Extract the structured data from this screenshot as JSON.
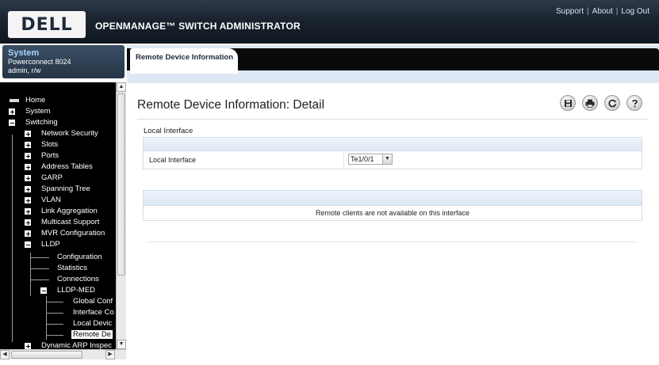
{
  "header": {
    "logo": "DELL",
    "product": "OPENMANAGE™ SWITCH ADMINISTRATOR",
    "links": [
      "Support",
      "About",
      "Log Out"
    ],
    "separator": "|"
  },
  "system_box": {
    "title": "System",
    "model": "Powerconnect 8024",
    "user": "admin, r/w"
  },
  "nav_tree": {
    "items": [
      {
        "label": "Home"
      },
      {
        "label": "System"
      },
      {
        "label": "Switching"
      },
      {
        "label": "Network Security"
      },
      {
        "label": "Slots"
      },
      {
        "label": "Ports"
      },
      {
        "label": "Address Tables"
      },
      {
        "label": "GARP"
      },
      {
        "label": "Spanning Tree"
      },
      {
        "label": "VLAN"
      },
      {
        "label": "Link Aggregation"
      },
      {
        "label": "Multicast Support"
      },
      {
        "label": "MVR Configuration"
      },
      {
        "label": "LLDP"
      },
      {
        "label": "Configuration"
      },
      {
        "label": "Statistics"
      },
      {
        "label": "Connections"
      },
      {
        "label": "LLDP-MED"
      },
      {
        "label": "Global Conf"
      },
      {
        "label": "Interface Co"
      },
      {
        "label": "Local Devic"
      },
      {
        "label": "Remote De"
      },
      {
        "label": "Dynamic ARP Inspec"
      }
    ],
    "selected": "Remote De"
  },
  "tab": {
    "label": "Remote Device Information"
  },
  "page": {
    "title": "Remote Device Information: Detail",
    "toolbar": [
      "save-icon",
      "print-icon",
      "refresh-icon",
      "help-icon"
    ],
    "local_section": {
      "title": "Local Interface",
      "field_label": "Local Interface",
      "selected_value": "Te1/0/1"
    },
    "remote_message": "Remote clients are not available on this interface"
  },
  "colors": {
    "header_bg": "#1a2430",
    "tree_bg": "#000000",
    "panel_header": "#dde8f4",
    "tab_strip": "#0a0a0a"
  }
}
